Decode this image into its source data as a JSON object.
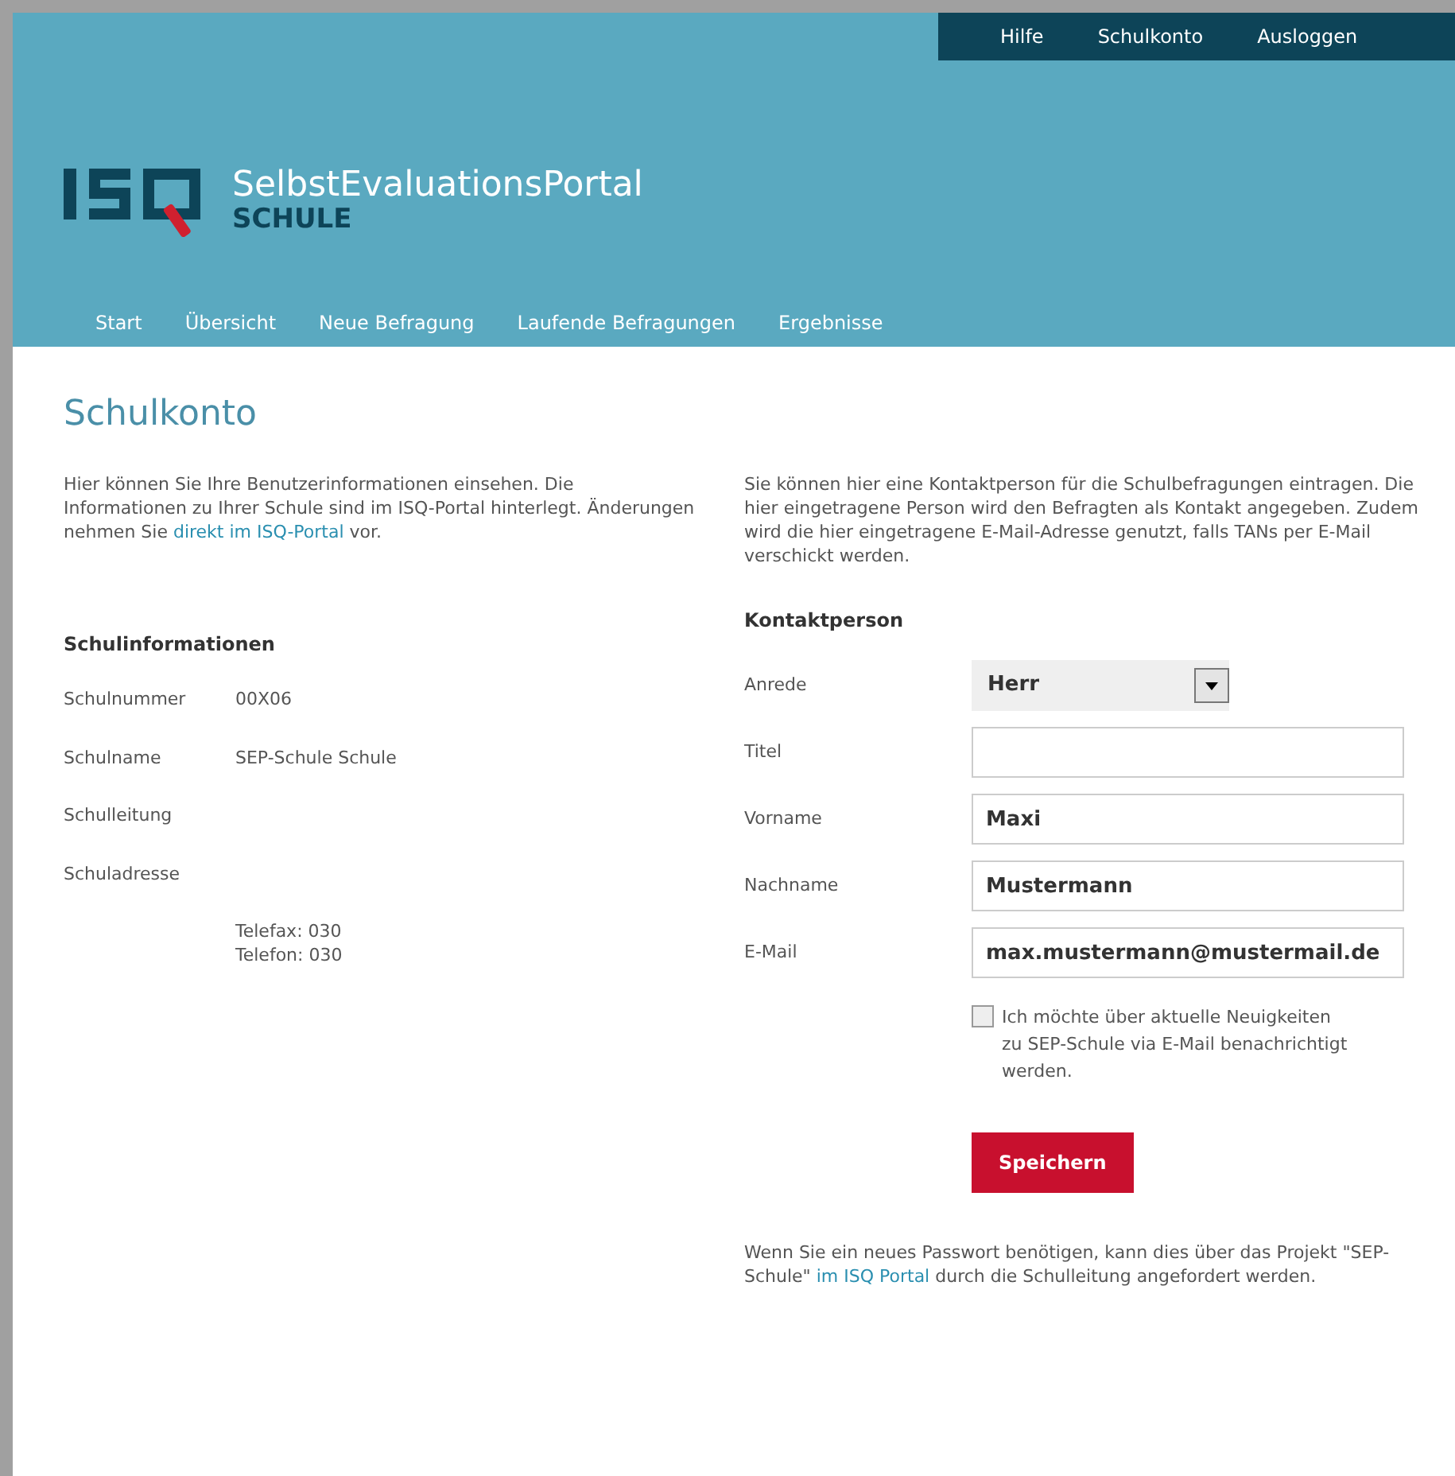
{
  "top_nav": [
    {
      "label": "Hilfe"
    },
    {
      "label": "Schulkonto"
    },
    {
      "label": "Ausloggen"
    }
  ],
  "logo": {
    "title": "SelbstEvaluationsPortal",
    "subtitle": "SCHULE"
  },
  "main_nav": [
    {
      "label": "Start"
    },
    {
      "label": "Übersicht"
    },
    {
      "label": "Neue Befragung"
    },
    {
      "label": "Laufende Befragungen"
    },
    {
      "label": "Ergebnisse"
    }
  ],
  "page_title": "Schulkonto",
  "intro_left": {
    "before": "Hier können Sie Ihre Benutzerinformationen einsehen. Die Informationen zu Ihrer Schule sind im ISQ-Portal hinterlegt. Änderungen nehmen Sie ",
    "link": "direkt im ISQ-Portal",
    "after": " vor."
  },
  "intro_right": "Sie können hier eine Kontaktperson für die Schulbefragungen eintragen. Die hier eingetragene Person wird den Befragten als Kontakt angegeben. Zudem wird die hier eingetragene E-Mail-Adresse genutzt, falls TANs per E-Mail verschickt werden.",
  "school_info": {
    "heading": "Schulinformationen",
    "rows": [
      {
        "label": "Schulnummer",
        "value": [
          "00X06"
        ]
      },
      {
        "label": "Schulname",
        "value": [
          "SEP-Schule Schule"
        ]
      },
      {
        "label": "Schulleitung"
      },
      {
        "label": "Schuladresse",
        "value": [
          "Telefax: 030",
          "Telefon: 030"
        ]
      }
    ]
  },
  "contact": {
    "heading": "Kontaktperson",
    "fields": [
      {
        "kind": "select",
        "label": "Anrede",
        "value": "Herr"
      },
      {
        "kind": "text",
        "label": "Titel"
      },
      {
        "kind": "text",
        "label": "Vorname",
        "value": "Maxi"
      },
      {
        "kind": "text",
        "label": "Nachname",
        "value": "Mustermann"
      },
      {
        "kind": "text",
        "label": "E-Mail",
        "value": "max.mustermann@mustermail.de"
      }
    ],
    "newsletter": {
      "label": "Ich möchte über aktuelle Neuigkeiten zu SEP-Schule via E-Mail benachrichtigt werden.",
      "checked": false
    },
    "save_button": "Speichern"
  },
  "password_note": {
    "before": "Wenn Sie ein neues Passwort benötigen, kann dies über das Projekt \"SEP-Schule\" ",
    "link": "im ISQ Portal",
    "after": " durch die Schulleitung angefordert werden."
  }
}
